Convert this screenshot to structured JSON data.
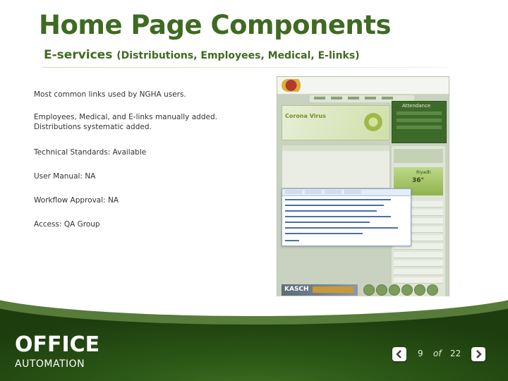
{
  "slide": {
    "title": "Home Page Components",
    "subtitle_main": "E-services",
    "subtitle_paren": "(Distributions, Employees, Medical, E-links)"
  },
  "content": {
    "line1": "Most common links used by NGHA users.",
    "line2a": "Employees, Medical, and E-links manually added.",
    "line2b": "Distributions systematic added.",
    "technical_label": "Technical Standards:",
    "technical_value": "Available",
    "manual_label": "User Manual:",
    "manual_value": "NA",
    "workflow_label": "Workflow Approval:",
    "workflow_value": "NA",
    "access_label": "Access:",
    "access_value": "QA Group"
  },
  "screenshot": {
    "banner_text": "Corona Virus",
    "attendance_label": "Attendance",
    "weather_city": "Riyadh",
    "weather_temp": "36°",
    "kasch_label": "KASCH"
  },
  "footer": {
    "brand": "OFFICE",
    "brand_sub": "AUTOMATION",
    "page_current": "9",
    "page_of": "of",
    "page_total": "22",
    "icons": {
      "prev": "chevron-left-icon",
      "next": "chevron-right-icon"
    }
  },
  "colors": {
    "title_green": "#3f6a22",
    "footer_green": "#2b5616"
  }
}
